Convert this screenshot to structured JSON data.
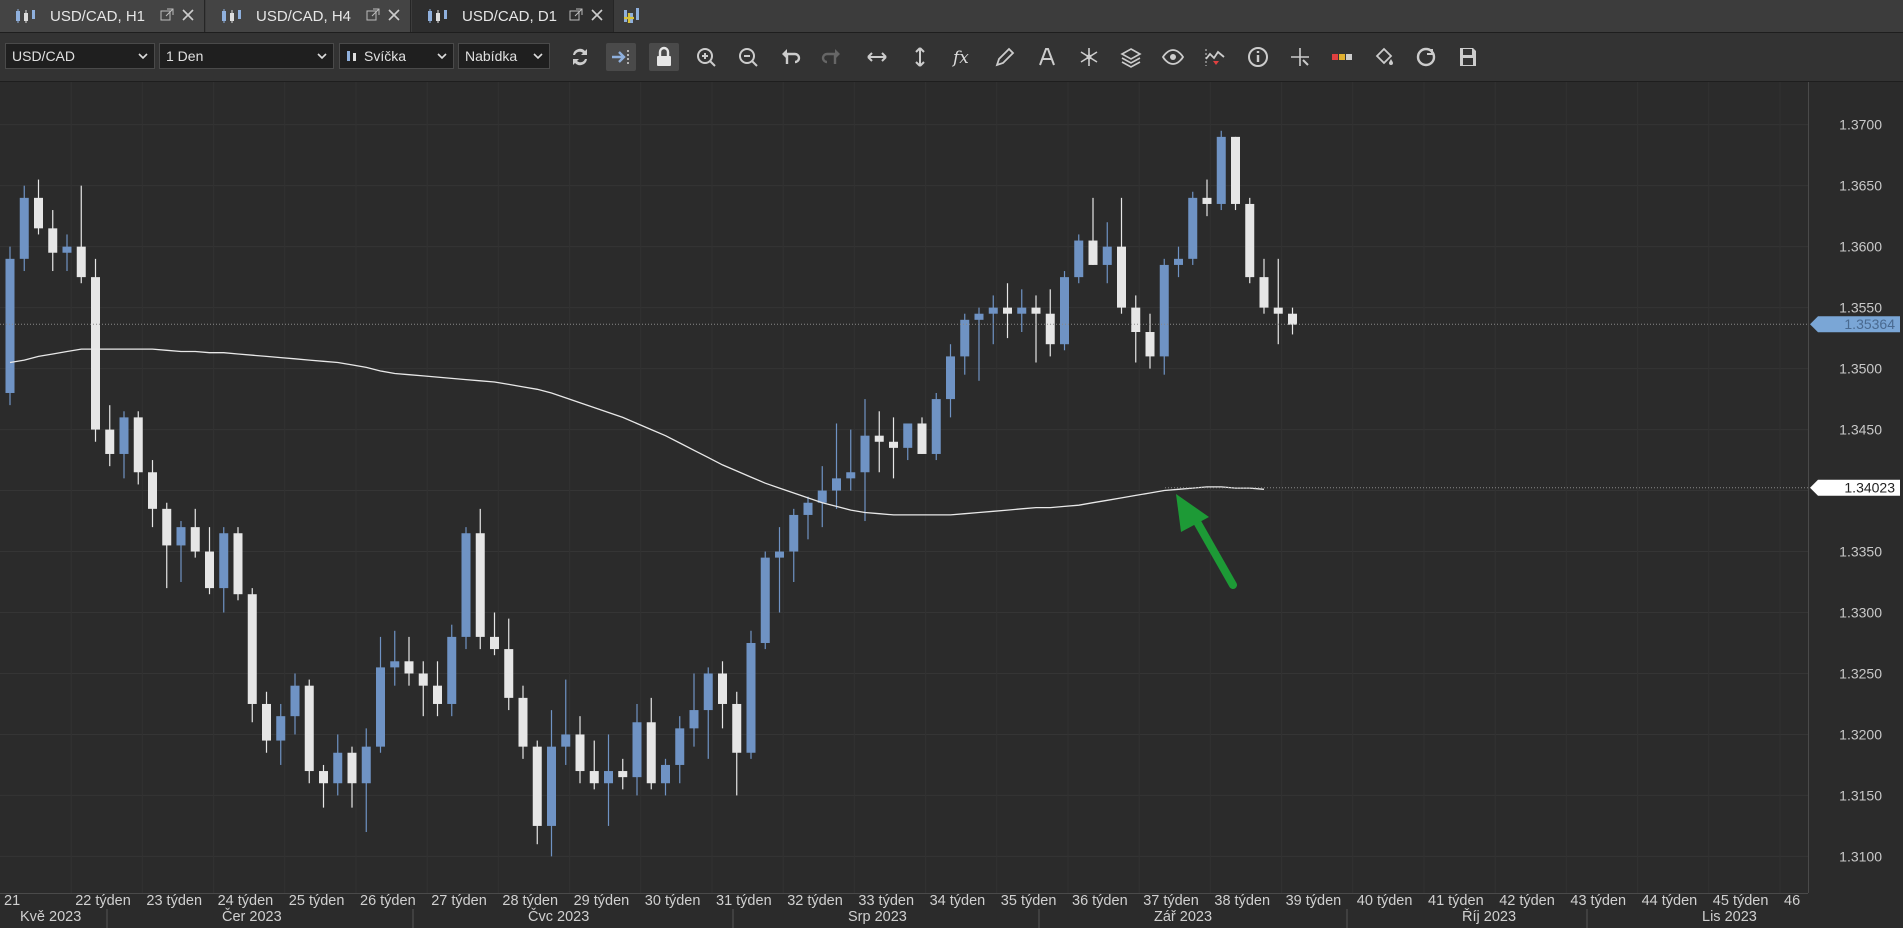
{
  "tabs": [
    {
      "label": "USD/CAD, H1",
      "active": false
    },
    {
      "label": "USD/CAD, H4",
      "active": false
    },
    {
      "label": "USD/CAD, D1",
      "active": true
    }
  ],
  "toolbar": {
    "symbol": "USD/CAD",
    "timeframe": "1 Den",
    "chart_type": "Svíčka",
    "price_side": "Nabídka",
    "tools": [
      "refresh-icon",
      "auto-scroll-icon",
      "lock-icon",
      "zoom-in-icon",
      "zoom-out-icon",
      "undo-icon",
      "redo-icon",
      "horizontal-scale-icon",
      "vertical-scale-icon",
      "indicator-fx-icon",
      "pencil-icon",
      "text-icon",
      "objects-icon",
      "layers-icon",
      "eye-icon",
      "signal-icon",
      "info-icon",
      "crosshair-icon",
      "ruler-icon",
      "paint-bucket-icon",
      "palette-refresh-icon",
      "save-icon"
    ]
  },
  "colors": {
    "background": "#2b2b2b",
    "bull_candle": "#6f93c4",
    "bear_candle": "#e6e6e6",
    "ma_line": "#e8e8e8",
    "price_marker_bg": "#7aa6d6",
    "arrow": "#1d9a36"
  },
  "chart_data": {
    "type": "candlestick",
    "instrument": "USD/CAD",
    "timeframe": "D1",
    "ylim": [
      1.307,
      1.3735
    ],
    "y_ticks": [
      "1.3700",
      "1.3650",
      "1.3600",
      "1.3550",
      "1.3500",
      "1.3450",
      "1.3400",
      "1.3350",
      "1.3300",
      "1.3250",
      "1.3200",
      "1.3150",
      "1.3100"
    ],
    "week_labels": [
      "21",
      "22 týden",
      "23 týden",
      "24 týden",
      "25 týden",
      "26 týden",
      "27 týden",
      "28 týden",
      "29 týden",
      "30 týden",
      "31 týden",
      "32 týden",
      "33 týden",
      "34 týden",
      "35 týden",
      "36 týden",
      "37 týden",
      "38 týden",
      "39 týden",
      "40 týden",
      "41 týden",
      "42 týden",
      "43 týden",
      "44 týden",
      "45 týden",
      "46"
    ],
    "month_labels": [
      "Kvě 2023",
      "Čer 2023",
      "Čvc 2023",
      "Srp 2023",
      "Zář 2023",
      "Říj 2023",
      "Lis 2023"
    ],
    "current_price_label": "1.35364",
    "current_price": 1.35364,
    "ma_price_label": "1.34023",
    "ma_price": 1.34023,
    "ohlc": [
      [
        1.348,
        1.36,
        1.347,
        1.359
      ],
      [
        1.359,
        1.365,
        1.358,
        1.364
      ],
      [
        1.364,
        1.3655,
        1.361,
        1.3615
      ],
      [
        1.3615,
        1.363,
        1.358,
        1.3595
      ],
      [
        1.3595,
        1.361,
        1.358,
        1.36
      ],
      [
        1.36,
        1.365,
        1.357,
        1.3575
      ],
      [
        1.3575,
        1.359,
        1.344,
        1.345
      ],
      [
        1.345,
        1.347,
        1.342,
        1.343
      ],
      [
        1.343,
        1.3465,
        1.341,
        1.346
      ],
      [
        1.346,
        1.3465,
        1.3405,
        1.3415
      ],
      [
        1.3415,
        1.3425,
        1.337,
        1.3385
      ],
      [
        1.3385,
        1.339,
        1.332,
        1.3355
      ],
      [
        1.3355,
        1.3375,
        1.3325,
        1.337
      ],
      [
        1.337,
        1.3385,
        1.3345,
        1.335
      ],
      [
        1.335,
        1.337,
        1.3315,
        1.332
      ],
      [
        1.332,
        1.337,
        1.33,
        1.3365
      ],
      [
        1.3365,
        1.337,
        1.331,
        1.3315
      ],
      [
        1.3315,
        1.332,
        1.321,
        1.3225
      ],
      [
        1.3225,
        1.3235,
        1.3185,
        1.3195
      ],
      [
        1.3195,
        1.3225,
        1.3175,
        1.3215
      ],
      [
        1.3215,
        1.325,
        1.32,
        1.324
      ],
      [
        1.324,
        1.3245,
        1.316,
        1.317
      ],
      [
        1.317,
        1.3175,
        1.314,
        1.316
      ],
      [
        1.316,
        1.32,
        1.315,
        1.3185
      ],
      [
        1.3185,
        1.319,
        1.314,
        1.316
      ],
      [
        1.316,
        1.3205,
        1.312,
        1.319
      ],
      [
        1.319,
        1.328,
        1.3185,
        1.3255
      ],
      [
        1.3255,
        1.3285,
        1.324,
        1.326
      ],
      [
        1.326,
        1.328,
        1.324,
        1.325
      ],
      [
        1.325,
        1.326,
        1.3215,
        1.324
      ],
      [
        1.324,
        1.326,
        1.3215,
        1.3225
      ],
      [
        1.3225,
        1.329,
        1.3215,
        1.328
      ],
      [
        1.328,
        1.337,
        1.327,
        1.3365
      ],
      [
        1.3365,
        1.3385,
        1.327,
        1.328
      ],
      [
        1.328,
        1.33,
        1.3265,
        1.327
      ],
      [
        1.327,
        1.3295,
        1.322,
        1.323
      ],
      [
        1.323,
        1.324,
        1.318,
        1.319
      ],
      [
        1.319,
        1.3195,
        1.311,
        1.3125
      ],
      [
        1.3125,
        1.322,
        1.31,
        1.319
      ],
      [
        1.319,
        1.3245,
        1.3175,
        1.32
      ],
      [
        1.32,
        1.3215,
        1.316,
        1.317
      ],
      [
        1.317,
        1.3195,
        1.3155,
        1.316
      ],
      [
        1.316,
        1.32,
        1.3125,
        1.317
      ],
      [
        1.317,
        1.318,
        1.3155,
        1.3165
      ],
      [
        1.3165,
        1.3225,
        1.315,
        1.321
      ],
      [
        1.321,
        1.323,
        1.3155,
        1.316
      ],
      [
        1.316,
        1.318,
        1.315,
        1.3175
      ],
      [
        1.3175,
        1.3215,
        1.316,
        1.3205
      ],
      [
        1.3205,
        1.325,
        1.319,
        1.322
      ],
      [
        1.322,
        1.3255,
        1.318,
        1.325
      ],
      [
        1.325,
        1.326,
        1.3205,
        1.3225
      ],
      [
        1.3225,
        1.3235,
        1.315,
        1.3185
      ],
      [
        1.3185,
        1.3285,
        1.318,
        1.3275
      ],
      [
        1.3275,
        1.335,
        1.327,
        1.3345
      ],
      [
        1.3345,
        1.337,
        1.33,
        1.335
      ],
      [
        1.335,
        1.3385,
        1.3325,
        1.338
      ],
      [
        1.338,
        1.3395,
        1.336,
        1.339
      ],
      [
        1.339,
        1.342,
        1.337,
        1.34
      ],
      [
        1.34,
        1.3455,
        1.3385,
        1.341
      ],
      [
        1.341,
        1.345,
        1.34,
        1.3415
      ],
      [
        1.3415,
        1.3475,
        1.3375,
        1.3445
      ],
      [
        1.3445,
        1.3465,
        1.3415,
        1.344
      ],
      [
        1.344,
        1.346,
        1.341,
        1.3435
      ],
      [
        1.3435,
        1.345,
        1.3425,
        1.3455
      ],
      [
        1.3455,
        1.346,
        1.343,
        1.343
      ],
      [
        1.343,
        1.348,
        1.3425,
        1.3475
      ],
      [
        1.3475,
        1.352,
        1.346,
        1.351
      ],
      [
        1.351,
        1.3545,
        1.3495,
        1.354
      ],
      [
        1.354,
        1.355,
        1.349,
        1.3545
      ],
      [
        1.3545,
        1.356,
        1.352,
        1.355
      ],
      [
        1.355,
        1.357,
        1.3525,
        1.3545
      ],
      [
        1.3545,
        1.3565,
        1.353,
        1.355
      ],
      [
        1.355,
        1.356,
        1.3505,
        1.3545
      ],
      [
        1.3545,
        1.3565,
        1.351,
        1.352
      ],
      [
        1.352,
        1.358,
        1.3515,
        1.3575
      ],
      [
        1.3575,
        1.361,
        1.357,
        1.3605
      ],
      [
        1.3605,
        1.364,
        1.3585,
        1.3585
      ],
      [
        1.3585,
        1.362,
        1.357,
        1.36
      ],
      [
        1.36,
        1.364,
        1.3545,
        1.355
      ],
      [
        1.355,
        1.356,
        1.3505,
        1.353
      ],
      [
        1.353,
        1.3545,
        1.35,
        1.351
      ],
      [
        1.351,
        1.359,
        1.3495,
        1.3585
      ],
      [
        1.3585,
        1.36,
        1.3575,
        1.359
      ],
      [
        1.359,
        1.3645,
        1.3585,
        1.364
      ],
      [
        1.364,
        1.3655,
        1.3625,
        1.3635
      ],
      [
        1.3635,
        1.3695,
        1.363,
        1.369
      ],
      [
        1.369,
        1.369,
        1.363,
        1.3635
      ],
      [
        1.3635,
        1.364,
        1.357,
        1.3575
      ],
      [
        1.3575,
        1.359,
        1.3545,
        1.355
      ],
      [
        1.355,
        1.359,
        1.352,
        1.3545
      ],
      [
        1.3545,
        1.355,
        1.3528,
        1.3536
      ]
    ],
    "ma": [
      1.3505,
      1.3507,
      1.351,
      1.3512,
      1.3514,
      1.3516,
      1.3516,
      1.3516,
      1.3516,
      1.3516,
      1.3516,
      1.3515,
      1.3514,
      1.3514,
      1.3513,
      1.3513,
      1.3512,
      1.3511,
      1.351,
      1.3509,
      1.3508,
      1.3507,
      1.3506,
      1.3505,
      1.3503,
      1.3501,
      1.3498,
      1.3496,
      1.3495,
      1.3494,
      1.3493,
      1.3492,
      1.3491,
      1.349,
      1.3489,
      1.3487,
      1.3485,
      1.3483,
      1.348,
      1.3476,
      1.3472,
      1.3468,
      1.3464,
      1.346,
      1.3455,
      1.345,
      1.3445,
      1.3439,
      1.3433,
      1.3427,
      1.3421,
      1.3416,
      1.3411,
      1.3406,
      1.3402,
      1.3398,
      1.3394,
      1.339,
      1.3387,
      1.3384,
      1.3382,
      1.3381,
      1.338,
      1.338,
      1.338,
      1.338,
      1.338,
      1.3381,
      1.3382,
      1.3383,
      1.3384,
      1.3385,
      1.3386,
      1.3386,
      1.3387,
      1.3388,
      1.339,
      1.3392,
      1.3394,
      1.3396,
      1.3398,
      1.34,
      1.3401,
      1.3402,
      1.3403,
      1.3403,
      1.3402,
      1.3402,
      1.3401
    ]
  }
}
